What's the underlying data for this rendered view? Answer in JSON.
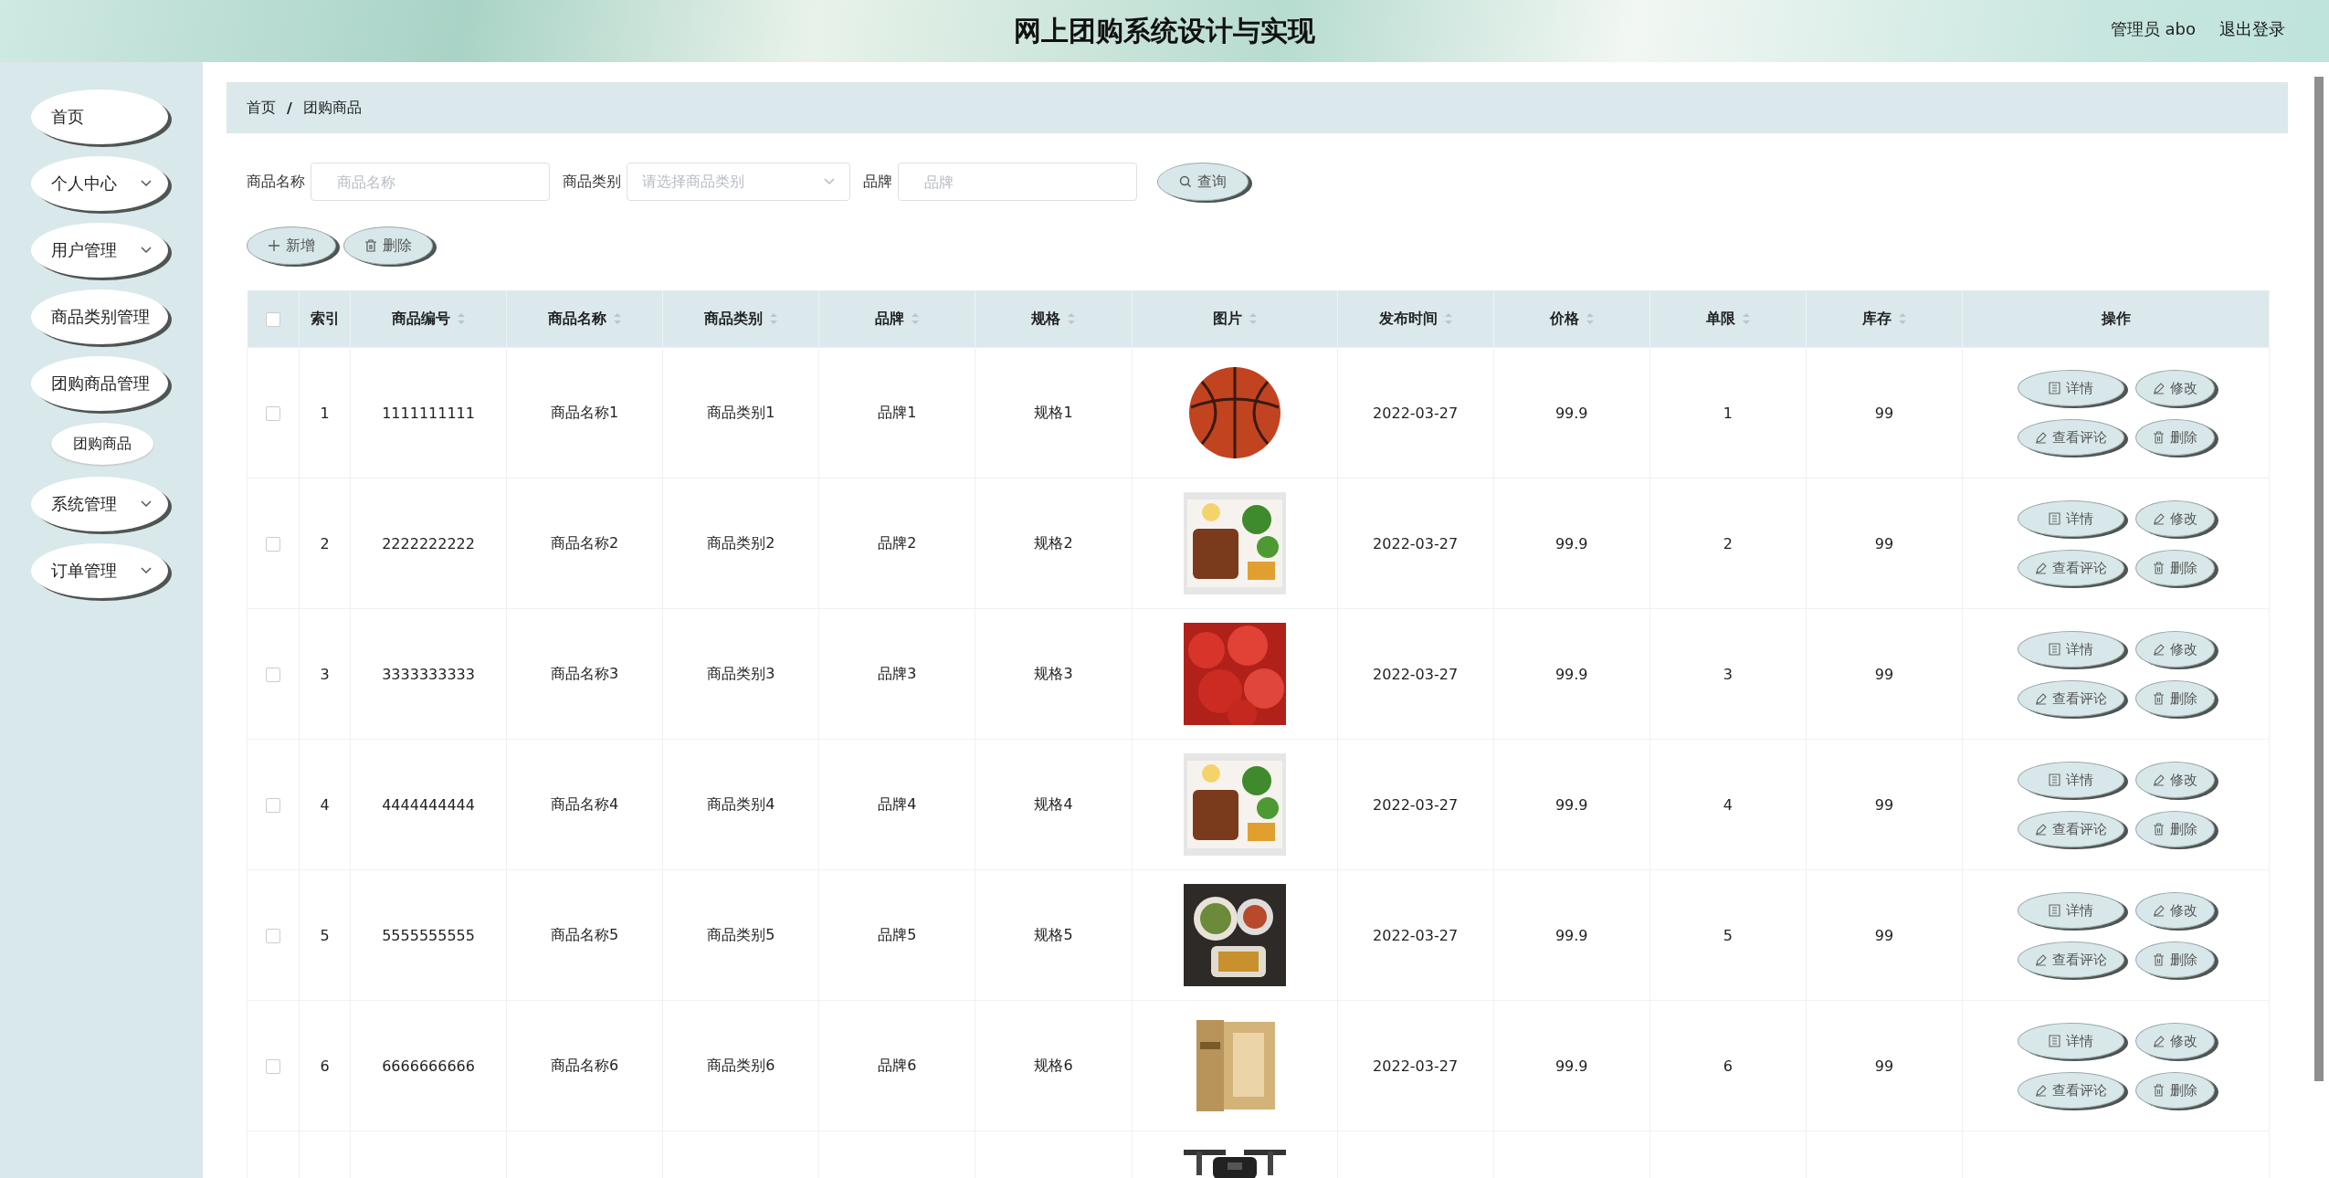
{
  "header": {
    "title": "网上团购系统设计与实现",
    "user": "管理员 abo",
    "logout": "退出登录"
  },
  "sidebar": {
    "items": [
      {
        "label": "首页",
        "expandable": false
      },
      {
        "label": "个人中心",
        "expandable": true
      },
      {
        "label": "用户管理",
        "expandable": true
      },
      {
        "label": "商品类别管理",
        "expandable": false
      },
      {
        "label": "团购商品管理",
        "expandable": false,
        "children": [
          {
            "label": "团购商品"
          }
        ]
      },
      {
        "label": "系统管理",
        "expandable": true
      },
      {
        "label": "订单管理",
        "expandable": true
      }
    ]
  },
  "breadcrumb": [
    "首页",
    "/",
    "团购商品"
  ],
  "search": {
    "fields": [
      {
        "kind": "input",
        "label": "商品名称",
        "placeholder": "商品名称"
      },
      {
        "kind": "select",
        "label": "商品类别",
        "placeholder": "请选择商品类别"
      },
      {
        "kind": "input",
        "label": "品牌",
        "placeholder": "品牌"
      }
    ],
    "button": "查询"
  },
  "toolbar": [
    {
      "kind": "add",
      "label": "新增"
    },
    {
      "kind": "delete",
      "label": "删除"
    }
  ],
  "table": {
    "columns": [
      {
        "kind": "checkbox",
        "checked": false
      },
      {
        "kind": "text",
        "label": "索引",
        "sortable": false
      },
      {
        "kind": "text",
        "label": "商品编号",
        "sortable": true
      },
      {
        "kind": "text",
        "label": "商品名称",
        "sortable": true
      },
      {
        "kind": "text",
        "label": "商品类别",
        "sortable": true
      },
      {
        "kind": "text",
        "label": "品牌",
        "sortable": true
      },
      {
        "kind": "text",
        "label": "规格",
        "sortable": true
      },
      {
        "kind": "text",
        "label": "图片",
        "sortable": true
      },
      {
        "kind": "text",
        "label": "发布时间",
        "sortable": true
      },
      {
        "kind": "text",
        "label": "价格",
        "sortable": true
      },
      {
        "kind": "text",
        "label": "单限",
        "sortable": true
      },
      {
        "kind": "text",
        "label": "库存",
        "sortable": true
      },
      {
        "kind": "text",
        "label": "操作",
        "sortable": false
      }
    ],
    "rows": [
      {
        "cells": [
          {
            "kind": "checkbox",
            "checked": false
          },
          "1",
          "1111111111",
          "商品名称1",
          "商品类别1",
          "品牌1",
          "规格1",
          {
            "kind": "picture"
          },
          "2022-03-27",
          "99.9",
          "1",
          "99",
          {
            "kind": "actions",
            "buttons": [
              {
                "kind": "detail",
                "label": "详情"
              },
              {
                "kind": "edit",
                "label": "修改"
              },
              {
                "kind": "comment",
                "label": "查看评论"
              },
              {
                "kind": "delete",
                "label": "删除"
              }
            ]
          }
        ]
      },
      {
        "cells": [
          {
            "kind": "checkbox",
            "checked": false
          },
          "2",
          "2222222222",
          "商品名称2",
          "商品类别2",
          "品牌2",
          "规格2",
          {
            "kind": "picture"
          },
          "2022-03-27",
          "99.9",
          "2",
          "99",
          {
            "kind": "actions",
            "buttons": [
              {
                "kind": "detail",
                "label": "详情"
              },
              {
                "kind": "edit",
                "label": "修改"
              },
              {
                "kind": "comment",
                "label": "查看评论"
              },
              {
                "kind": "delete",
                "label": "删除"
              }
            ]
          }
        ]
      },
      {
        "cells": [
          {
            "kind": "checkbox",
            "checked": false
          },
          "3",
          "3333333333",
          "商品名称3",
          "商品类别3",
          "品牌3",
          "规格3",
          {
            "kind": "picture"
          },
          "2022-03-27",
          "99.9",
          "3",
          "99",
          {
            "kind": "actions",
            "buttons": [
              {
                "kind": "detail",
                "label": "详情"
              },
              {
                "kind": "edit",
                "label": "修改"
              },
              {
                "kind": "comment",
                "label": "查看评论"
              },
              {
                "kind": "delete",
                "label": "删除"
              }
            ]
          }
        ]
      },
      {
        "cells": [
          {
            "kind": "checkbox",
            "checked": false
          },
          "4",
          "4444444444",
          "商品名称4",
          "商品类别4",
          "品牌4",
          "规格4",
          {
            "kind": "picture"
          },
          "2022-03-27",
          "99.9",
          "4",
          "99",
          {
            "kind": "actions",
            "buttons": [
              {
                "kind": "detail",
                "label": "详情"
              },
              {
                "kind": "edit",
                "label": "修改"
              },
              {
                "kind": "comment",
                "label": "查看评论"
              },
              {
                "kind": "delete",
                "label": "删除"
              }
            ]
          }
        ]
      },
      {
        "cells": [
          {
            "kind": "checkbox",
            "checked": false
          },
          "5",
          "5555555555",
          "商品名称5",
          "商品类别5",
          "品牌5",
          "规格5",
          {
            "kind": "picture"
          },
          "2022-03-27",
          "99.9",
          "5",
          "99",
          {
            "kind": "actions",
            "buttons": [
              {
                "kind": "detail",
                "label": "详情"
              },
              {
                "kind": "edit",
                "label": "修改"
              },
              {
                "kind": "comment",
                "label": "查看评论"
              },
              {
                "kind": "delete",
                "label": "删除"
              }
            ]
          }
        ]
      },
      {
        "cells": [
          {
            "kind": "checkbox",
            "checked": false
          },
          "6",
          "6666666666",
          "商品名称6",
          "商品类别6",
          "品牌6",
          "规格6",
          {
            "kind": "picture"
          },
          "2022-03-27",
          "99.9",
          "6",
          "99",
          {
            "kind": "actions",
            "buttons": [
              {
                "kind": "detail",
                "label": "详情"
              },
              {
                "kind": "edit",
                "label": "修改"
              },
              {
                "kind": "comment",
                "label": "查看评论"
              },
              {
                "kind": "delete",
                "label": "删除"
              }
            ]
          }
        ]
      },
      {
        "cells": [
          {
            "kind": "picture"
          }
        ]
      }
    ]
  }
}
